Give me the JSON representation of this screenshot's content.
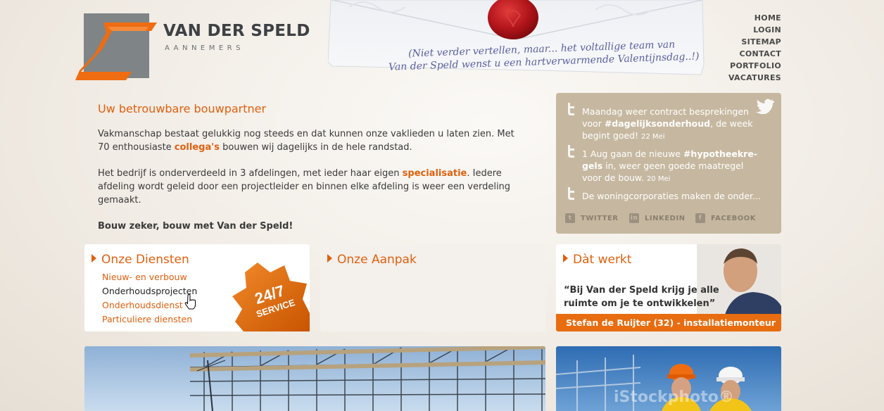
{
  "logo": {
    "name": "VAN DER SPELD",
    "subtitle": "AANNEMERS"
  },
  "banner": {
    "line1": "(Niet verder vertellen, maar... het voltallige team van",
    "line2": "Van der Speld wenst u een hartverwarmende Valentijnsdag..!)"
  },
  "nav": {
    "items": [
      "HOME",
      "LOGIN",
      "SITEMAP",
      "CONTACT",
      "PORTFOLIO",
      "VACATURES"
    ]
  },
  "intro": {
    "title": "Uw betrouwbare bouwpartner",
    "p1a": "Vakmanschap bestaat gelukkig nog steeds en dat kunnen onze vaklieden u laten zien. Met 70 enthousiaste ",
    "p1link": "collega's",
    "p1b": " bouwen wij dagelijks in de hele randstad.",
    "p2a": "Het bedrijf is onderverdeeld in 3 afdelingen, met ieder haar eigen ",
    "p2link": "specialisatie",
    "p2b": ". Iedere afdeling wordt geleid door een projectleider en binnen elke afdeling is weer een verdeling gemaakt.",
    "p3": "Bouw zeker, bouw met Van der Speld!"
  },
  "twitter": {
    "tweets": [
      {
        "a": "Maandag weer contract besprekingen voor ",
        "tag": "#dagelijksonderhoud",
        "b": ", de week begint goed! ",
        "date": "22 Mei"
      },
      {
        "a": "1 Aug gaan de nieuwe ",
        "tag": "#hypotheekre-gels",
        "b": " in, weer geen goede maatregel voor de bouw. ",
        "date": "20 Mei"
      },
      {
        "a": "De woningcorporaties maken de onder...",
        "tag": "",
        "b": "",
        "date": ""
      }
    ],
    "social": [
      "TWITTER",
      "LINKEDIN",
      "FACEBOOK"
    ],
    "colors": {
      "box": "#c6b8a0"
    }
  },
  "diensten": {
    "title": "Onze Diensten",
    "items": [
      "Nieuw- en verbouw",
      "Onderhoudsprojecten",
      "Onderhoudsdienst",
      "Particuliere diensten"
    ],
    "badge_top": "24/7",
    "badge_bottom": "SERVICE"
  },
  "aanpak": {
    "title": "Onze Aanpak"
  },
  "werkt": {
    "title": "Dàt werkt",
    "quote": "“Bij Van der Speld krijg je alle ruimte om je te ontwikkelen”",
    "caption": "Stefan de Ruijter (32) - installatiemonteur"
  },
  "photo2": {
    "watermark": "iStockphoto®"
  },
  "colors": {
    "accent": "#e0600e",
    "logo_gray": "#7f8586"
  }
}
